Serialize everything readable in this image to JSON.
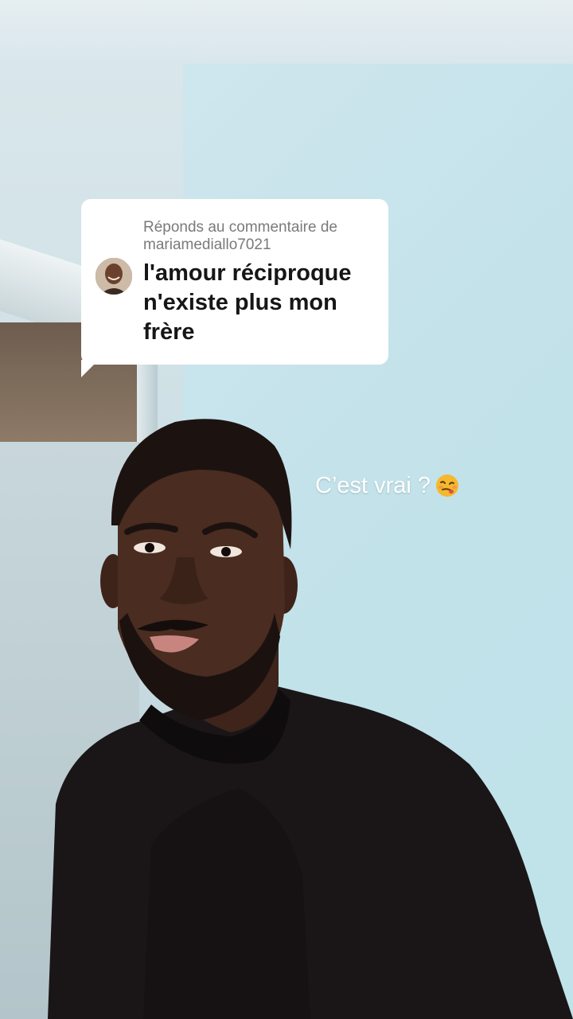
{
  "reply": {
    "header": "Réponds au commentaire de",
    "username": "mariamediallo7021",
    "comment": "l'amour réciproque n'existe plus mon frère"
  },
  "caption": {
    "text": "C’est vrai ?",
    "emoji": "woozy-face-emoji"
  },
  "colors": {
    "card_bg": "#ffffff",
    "header_text": "#7a7a7a",
    "comment_text": "#161616",
    "caption_text": "#ffffff",
    "shirt": "#1a1617",
    "skin": "#4a2c20"
  }
}
